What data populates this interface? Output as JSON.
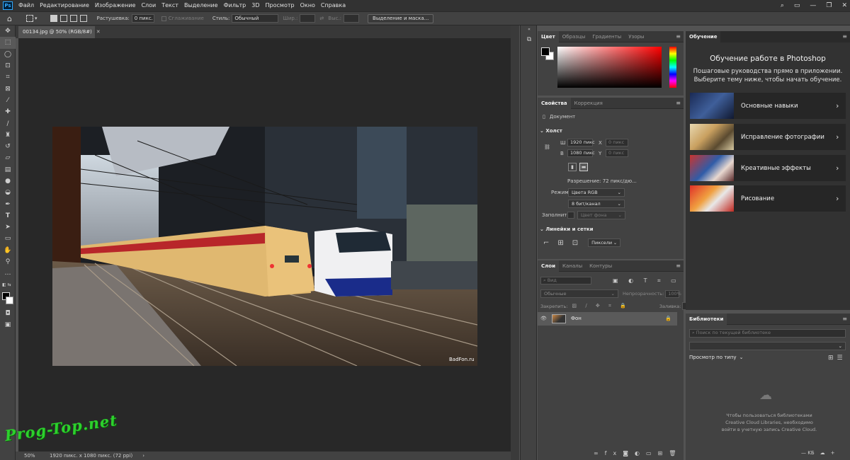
{
  "menubar": {
    "logo": "Ps",
    "items": [
      "Файл",
      "Редактирование",
      "Изображение",
      "Слои",
      "Текст",
      "Выделение",
      "Фильтр",
      "3D",
      "Просмотр",
      "Окно",
      "Справка"
    ]
  },
  "options": {
    "feather_label": "Растушевка:",
    "feather_value": "0 пикс.",
    "antialias_label": "Сглаживание",
    "style_label": "Стиль:",
    "style_value": "Обычный",
    "width_label": "Шир.:",
    "height_label": "Выс.:",
    "select_mask_button": "Выделение и маска..."
  },
  "document": {
    "tab_title": "00134.jpg @ 50% (RGB/8#)",
    "image_credit": "BadFon.ru"
  },
  "status": {
    "zoom": "50%",
    "info": "1920 пикс. x 1080 пикс. (72 ppi)"
  },
  "watermark": "Prog-Top.net",
  "color_panel": {
    "tabs": [
      "Цвет",
      "Образцы",
      "Градиенты",
      "Узоры"
    ],
    "fg": "#000000",
    "bg": "#ffffff"
  },
  "properties": {
    "tabs": [
      "Свойства",
      "Коррекция"
    ],
    "doc_label": "Документ",
    "canvas_header": "Холст",
    "w_label": "Ш",
    "w_value": "1920 пикс",
    "h_label": "В",
    "h_value": "1080 пикс",
    "x_label": "X",
    "x_value": "0 пикс",
    "y_label": "Y",
    "y_value": "0 пикс",
    "resolution": "Разрешение: 72 пикс/дю...",
    "mode_label": "Режим",
    "mode_value": "Цвета RGB",
    "bits_value": "8 бит/канал",
    "fill_label": "Заполнить",
    "fill_value": "Цвет фона",
    "rulers_header": "Линейки и сетки",
    "units_value": "Пиксели"
  },
  "layers": {
    "tabs": [
      "Слои",
      "Каналы",
      "Контуры"
    ],
    "search_placeholder": "Вид",
    "blend_mode": "Обычные",
    "opacity_label": "Непрозрачность:",
    "opacity_value": "100%",
    "lock_label": "Закрепить:",
    "fill_label": "Заливка:",
    "fill_value": "100%",
    "layer_name": "Фон"
  },
  "learn": {
    "tab": "Обучение",
    "title": "Обучение работе в Photoshop",
    "subtitle": "Пошаговые руководства прямо в приложении. Выберите тему ниже, чтобы начать обучение.",
    "cards": [
      "Основные навыки",
      "Исправление фотографии",
      "Креативные эффекты",
      "Рисование"
    ]
  },
  "libraries": {
    "tab": "Библиотеки",
    "search_placeholder": "Поиск по текущей библиотеке",
    "view_label": "Просмотр по типу",
    "message": "Чтобы пользоваться библиотеками Creative Cloud Libraries, необходимо войти в учетную запись Creative Cloud.",
    "size_label": "— KБ"
  }
}
